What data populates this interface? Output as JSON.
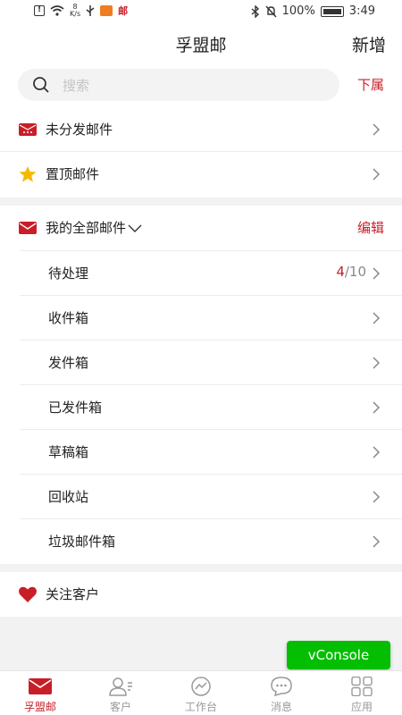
{
  "status_bar": {
    "speed_top": "8",
    "speed_unit": "K/s",
    "battery": "100%",
    "time": "3:49",
    "red_app": "邮"
  },
  "header": {
    "title": "孚盟邮",
    "add_label": "新增"
  },
  "search": {
    "placeholder": "搜索",
    "subordinate_label": "下属"
  },
  "top_items": [
    {
      "label": "未分发邮件",
      "icon": "undistributed-mail-icon"
    },
    {
      "label": "置顶邮件",
      "icon": "star-icon"
    }
  ],
  "all_mail": {
    "label": "我的全部邮件",
    "edit_label": "编辑",
    "folders": [
      {
        "label": "待处理",
        "count_unread": "4",
        "count_total": "/10"
      },
      {
        "label": "收件箱"
      },
      {
        "label": "发件箱"
      },
      {
        "label": "已发件箱"
      },
      {
        "label": "草稿箱"
      },
      {
        "label": "回收站"
      },
      {
        "label": "垃圾邮件箱"
      }
    ]
  },
  "favorite": {
    "label": "关注客户",
    "icon": "heart-icon"
  },
  "vconsole": "vConsole",
  "tabs": [
    {
      "label": "孚盟邮",
      "icon": "mail-icon",
      "active": true
    },
    {
      "label": "客户",
      "icon": "customer-icon",
      "active": false
    },
    {
      "label": "工作台",
      "icon": "workbench-icon",
      "active": false
    },
    {
      "label": "消息",
      "icon": "message-icon",
      "active": false
    },
    {
      "label": "应用",
      "icon": "apps-icon",
      "active": false
    }
  ],
  "colors": {
    "accent": "#c81e28",
    "vconsole": "#04be02",
    "star": "#f5b800"
  }
}
